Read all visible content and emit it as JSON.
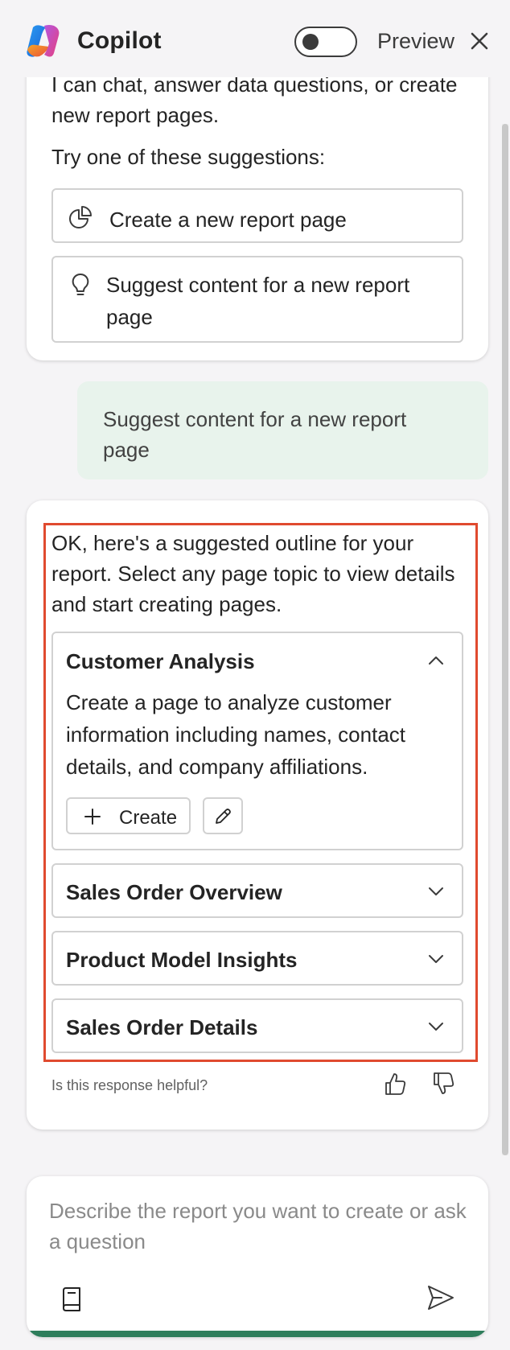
{
  "header": {
    "title": "Copilot",
    "toggle_label": "Preview",
    "toggle_on": false,
    "icons": [
      "copilot-logo",
      "close-icon"
    ]
  },
  "intro": {
    "message": "I can chat, answer data questions, or create new report pages.",
    "try_text": "Try one of these suggestions:",
    "suggestions": [
      {
        "label": "Create a new report page",
        "icon": "pie-chart-icon"
      },
      {
        "label": "Suggest content for a new report page",
        "icon": "lightbulb-icon"
      }
    ]
  },
  "user_message": "Suggest content for a new report page",
  "response": {
    "text": "OK, here's a suggested outline for your report. Select any page topic to view details and start creating pages.",
    "topics": [
      {
        "title": "Customer Analysis",
        "expanded": true,
        "description": "Create a page to analyze customer information including names, contact details, and company affiliations.",
        "create_label": "Create"
      },
      {
        "title": "Sales Order Overview",
        "expanded": false
      },
      {
        "title": "Product Model Insights",
        "expanded": false
      },
      {
        "title": "Sales Order Details",
        "expanded": false
      }
    ],
    "feedback_prompt": "Is this response helpful?"
  },
  "composer": {
    "placeholder": "Describe the report you want to create or ask a question"
  },
  "colors": {
    "accent_green": "#2e7d5b",
    "user_bubble": "#e8f3ec",
    "highlight_border": "#e04a2f"
  }
}
